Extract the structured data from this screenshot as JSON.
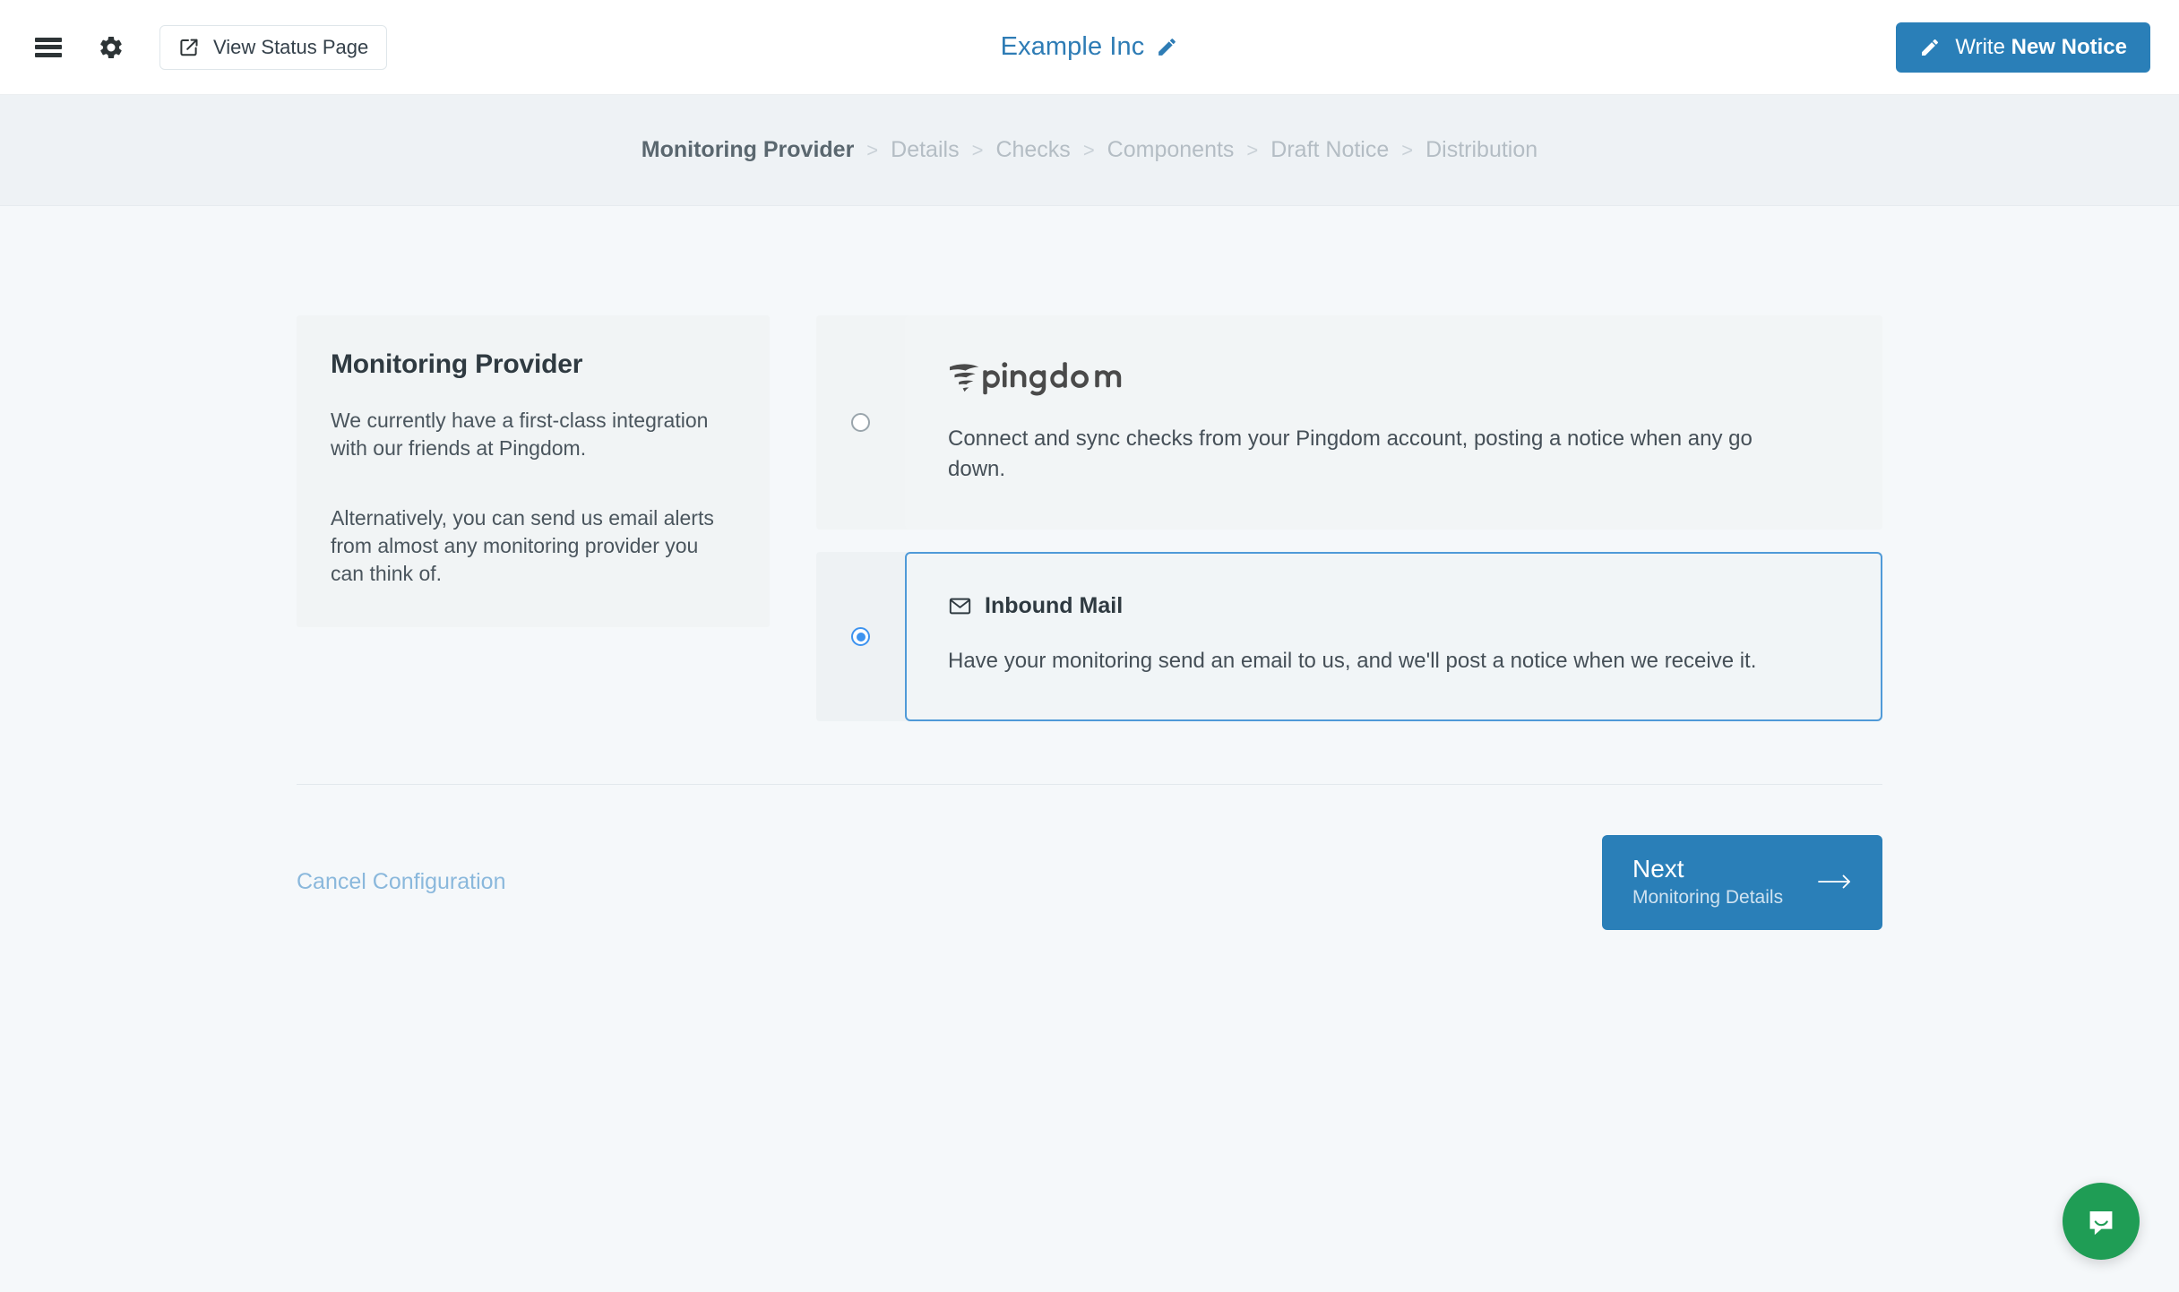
{
  "header": {
    "menu_icon": "hamburger-icon",
    "settings_icon": "gear-icon",
    "status_page_button": "View Status Page",
    "status_page_icon": "external-link-icon",
    "org_title": "Example Inc",
    "org_edit_icon": "pencil-icon",
    "write_notice_prefix": "Write ",
    "write_notice_bold": "New Notice",
    "write_notice_icon": "pencil-icon",
    "accent_color": "#2a7fb8",
    "title_color": "#2e7cb5"
  },
  "breadcrumb": {
    "separator": ">",
    "items": [
      {
        "label": "Monitoring Provider",
        "active": true
      },
      {
        "label": "Details",
        "active": false
      },
      {
        "label": "Checks",
        "active": false
      },
      {
        "label": "Components",
        "active": false
      },
      {
        "label": "Draft Notice",
        "active": false
      },
      {
        "label": "Distribution",
        "active": false
      }
    ]
  },
  "info_card": {
    "title": "Monitoring Provider",
    "paragraph_1": "We currently have a first-class integration with our friends at Pingdom.",
    "paragraph_2": "Alternatively, you can send us email alerts from almost any monitoring provider you can think of."
  },
  "options": [
    {
      "id": "pingdom",
      "logo_text": "pingdom",
      "logo_icon": "pingdom-logo",
      "description": "Connect and sync checks from your Pingdom account, posting a notice when any go down.",
      "selected": false
    },
    {
      "id": "inbound-mail",
      "label": "Inbound Mail",
      "icon": "envelope-icon",
      "description": "Have your monitoring send an email to us, and we'll post a notice when we receive it.",
      "selected": true,
      "border_color": "#4f9ad8"
    }
  ],
  "footer": {
    "cancel_label": "Cancel Configuration",
    "cancel_color": "#8ab8dc",
    "next_primary": "Next",
    "next_secondary": "Monitoring Details",
    "next_icon": "arrow-right-icon"
  },
  "chat": {
    "icon": "chat-bubble-icon",
    "color": "#1f9d55"
  }
}
